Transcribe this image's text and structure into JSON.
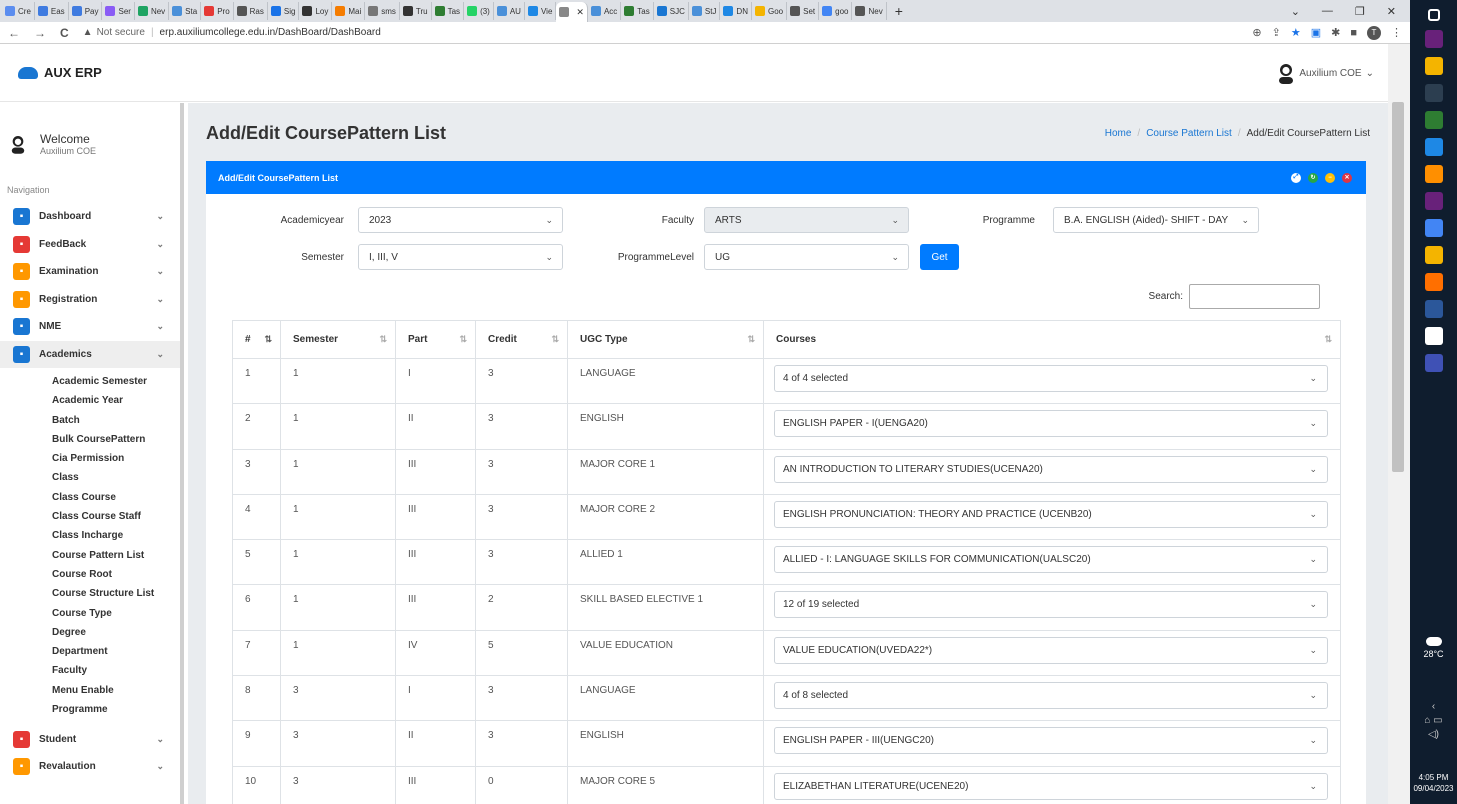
{
  "browser": {
    "tabs": [
      {
        "label": "Cre",
        "color": "#5b8def"
      },
      {
        "label": "Eas",
        "color": "#3f7be0"
      },
      {
        "label": "Pay",
        "color": "#3f7be0"
      },
      {
        "label": "Ser",
        "color": "#8a5cf5"
      },
      {
        "label": "Nev",
        "color": "#1fa463"
      },
      {
        "label": "Sta",
        "color": "#4a90d9"
      },
      {
        "label": "Pro",
        "color": "#e53935"
      },
      {
        "label": "Ras",
        "color": "#555555"
      },
      {
        "label": "Sig",
        "color": "#1a73e8"
      },
      {
        "label": "Loy",
        "color": "#333333"
      },
      {
        "label": "Mai",
        "color": "#f57c00"
      },
      {
        "label": "sms",
        "color": "#777777"
      },
      {
        "label": "Tru",
        "color": "#333333"
      },
      {
        "label": "Tas",
        "color": "#2e7d32"
      },
      {
        "label": "(3)",
        "color": "#25d366"
      },
      {
        "label": "AU",
        "color": "#4a90d9"
      },
      {
        "label": "Vie",
        "color": "#1e88e5"
      },
      {
        "label": "",
        "color": "#888888",
        "active": true
      },
      {
        "label": "Acc",
        "color": "#4a90d9"
      },
      {
        "label": "Tas",
        "color": "#2e7d32"
      },
      {
        "label": "SJC",
        "color": "#1976d2"
      },
      {
        "label": "StJ",
        "color": "#4a90d9"
      },
      {
        "label": "DN",
        "color": "#1e88e5"
      },
      {
        "label": "Goo",
        "color": "#f4b400"
      },
      {
        "label": "Set",
        "color": "#555555"
      },
      {
        "label": "goo",
        "color": "#4285f4"
      },
      {
        "label": "Nev",
        "color": "#555555"
      }
    ],
    "new_tab": "+",
    "back": "←",
    "forward": "→",
    "reload": "C",
    "security": "Not secure",
    "url": "erp.auxiliumcollege.edu.in/DashBoard/DashBoard",
    "profile_initial": "T"
  },
  "taskbar": {
    "temperature": "28°C",
    "time": "4:05 PM",
    "date": "09/04/2023",
    "icons": [
      "#ffffff",
      "#68217a",
      "#f4b400",
      "#2c3e50",
      "#2e7d32",
      "#1e88e5",
      "#ff8f00",
      "#68217a",
      "#4285f4",
      "#f4b400",
      "#ff6f00",
      "#2b579a",
      "#ffffff",
      "#3f51b5"
    ]
  },
  "app": {
    "logo_text": "AUX ERP",
    "user_name": "Auxilium COE",
    "welcome_title": "Welcome",
    "welcome_sub": "Auxilium COE",
    "nav_label": "Navigation"
  },
  "sidebar": {
    "menu_top": [
      {
        "label": "Dashboard",
        "color": "#1976d2",
        "name": "sidebar-item-dashboard"
      },
      {
        "label": "FeedBack",
        "color": "#e53935",
        "name": "sidebar-item-feedback"
      },
      {
        "label": "Examination",
        "color": "#ff9800",
        "name": "sidebar-item-examination"
      },
      {
        "label": "Registration",
        "color": "#ff9800",
        "name": "sidebar-item-registration"
      },
      {
        "label": "NME",
        "color": "#1976d2",
        "name": "sidebar-item-nme"
      },
      {
        "label": "Academics",
        "color": "#1976d2",
        "name": "sidebar-item-academics",
        "active": true
      }
    ],
    "academics_sub": [
      "Academic Semester",
      "Academic Year",
      "Batch",
      "Bulk CoursePattern",
      "Cia Permission",
      "Class",
      "Class Course",
      "Class Course Staff",
      "Class Incharge",
      "Course Pattern List",
      "Course Root",
      "Course Structure List",
      "Course Type",
      "Degree",
      "Department",
      "Faculty",
      "Menu Enable",
      "Programme"
    ],
    "menu_bottom": [
      {
        "label": "Student",
        "color": "#e53935",
        "name": "sidebar-item-student"
      },
      {
        "label": "Revalaution",
        "color": "#ff9800",
        "name": "sidebar-item-revalaution"
      }
    ]
  },
  "page": {
    "title": "Add/Edit CoursePattern List",
    "breadcrumb": [
      "Home",
      "Course Pattern List",
      "Add/Edit CoursePattern List"
    ],
    "panel_title": "Add/Edit CoursePattern List"
  },
  "filters": {
    "academicyear_label": "Academicyear",
    "academicyear_value": "2023",
    "faculty_label": "Faculty",
    "faculty_value": "ARTS",
    "programme_label": "Programme",
    "programme_value": "B.A. ENGLISH (Aided)- SHIFT - DAY",
    "semester_label": "Semester",
    "semester_value": "I, III, V",
    "programmelevel_label": "ProgrammeLevel",
    "programmelevel_value": "UG",
    "get_label": "Get",
    "search_label": "Search:"
  },
  "table": {
    "headers": [
      "#",
      "Semester",
      "Part",
      "Credit",
      "UGC Type",
      "Courses"
    ],
    "rows": [
      [
        "1",
        "1",
        "I",
        "3",
        "LANGUAGE",
        "4 of 4 selected"
      ],
      [
        "2",
        "1",
        "II",
        "3",
        "ENGLISH",
        "ENGLISH PAPER - I(UENGA20)"
      ],
      [
        "3",
        "1",
        "III",
        "3",
        "MAJOR CORE 1",
        "AN INTRODUCTION TO LITERARY STUDIES(UCENA20)"
      ],
      [
        "4",
        "1",
        "III",
        "3",
        "MAJOR CORE 2",
        "ENGLISH PRONUNCIATION: THEORY AND PRACTICE (UCENB20)"
      ],
      [
        "5",
        "1",
        "III",
        "3",
        "ALLIED 1",
        "ALLIED - I: LANGUAGE SKILLS FOR COMMUNICATION(UALSC20)"
      ],
      [
        "6",
        "1",
        "III",
        "2",
        "SKILL BASED ELECTIVE 1",
        "12 of 19 selected"
      ],
      [
        "7",
        "1",
        "IV",
        "5",
        "VALUE EDUCATION",
        "VALUE EDUCATION(UVEDA22*)"
      ],
      [
        "8",
        "3",
        "I",
        "3",
        "LANGUAGE",
        "4 of 8 selected"
      ],
      [
        "9",
        "3",
        "II",
        "3",
        "ENGLISH",
        "ENGLISH PAPER - III(UENGC20)"
      ],
      [
        "10",
        "3",
        "III",
        "0",
        "MAJOR CORE 5",
        "ELIZABETHAN LITERATURE(UCENE20)"
      ]
    ]
  }
}
